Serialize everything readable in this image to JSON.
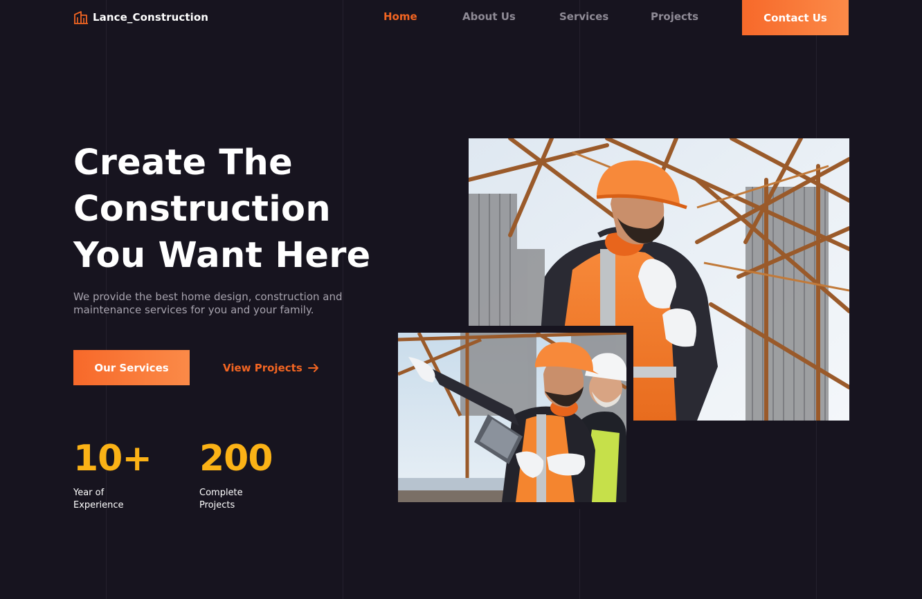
{
  "brand": {
    "name": "Lance_Construction",
    "icon": "building-icon",
    "accent": "#f26522"
  },
  "nav": {
    "items": [
      {
        "label": "Home",
        "active": true
      },
      {
        "label": "About Us",
        "active": false
      },
      {
        "label": "Services",
        "active": false
      },
      {
        "label": "Projects",
        "active": false
      }
    ],
    "cta": "Contact Us"
  },
  "hero": {
    "title_lines": [
      "Create The",
      "Construction",
      "You Want Here"
    ],
    "description": "We provide the best home design, construction and maintenance services for you and your family.",
    "primary_button": "Our Services",
    "secondary_button": "View Projects",
    "secondary_icon": "arrow-right-icon"
  },
  "stats": [
    {
      "value": "10+",
      "label": "Year of Experience"
    },
    {
      "value": "200",
      "label": "Complete Projects"
    }
  ],
  "colors": {
    "background": "#17141f",
    "accent": "#f26522",
    "stat_yellow": "#fbb216"
  }
}
